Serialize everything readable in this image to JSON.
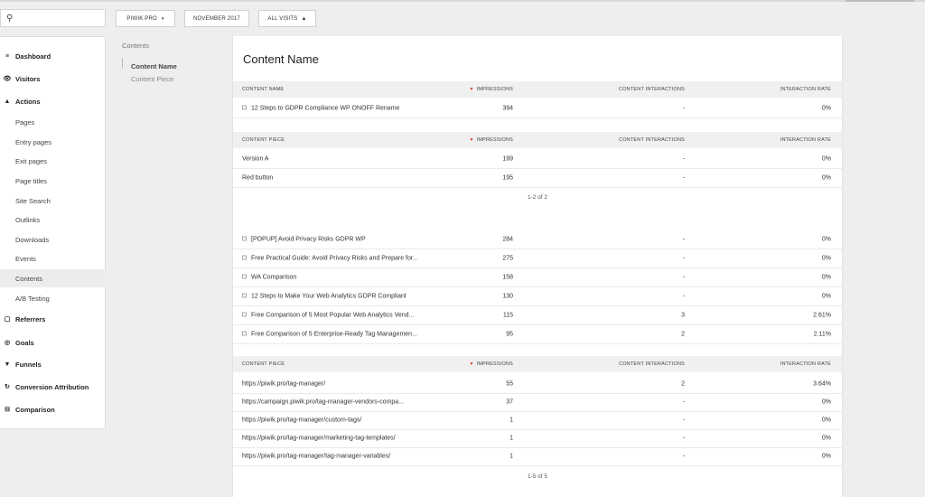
{
  "search": {
    "value": ""
  },
  "topbar": {
    "site": "PIWIK.PRO",
    "period": "NOVEMBER 2017",
    "segment": "ALL VISITS"
  },
  "sidebar": {
    "items": [
      {
        "label": "Dashboard",
        "icon": "hamburger-icon",
        "glyph": "≡",
        "level": "top"
      },
      {
        "label": "Visitors",
        "icon": "eye-icon",
        "glyph": "👁",
        "level": "top"
      },
      {
        "label": "Actions",
        "icon": "pin-icon",
        "glyph": "▲",
        "level": "top"
      },
      {
        "label": "Pages",
        "level": "sub"
      },
      {
        "label": "Entry pages",
        "level": "sub"
      },
      {
        "label": "Exit pages",
        "level": "sub"
      },
      {
        "label": "Page titles",
        "level": "sub"
      },
      {
        "label": "Site Search",
        "level": "sub"
      },
      {
        "label": "Outlinks",
        "level": "sub"
      },
      {
        "label": "Downloads",
        "level": "sub"
      },
      {
        "label": "Events",
        "level": "sub"
      },
      {
        "label": "Contents",
        "level": "sub",
        "active": true
      },
      {
        "label": "A/B Testing",
        "level": "sub"
      },
      {
        "label": "Referrers",
        "icon": "referrers-icon",
        "glyph": "▢",
        "level": "top"
      },
      {
        "label": "Goals",
        "icon": "target-icon",
        "glyph": "◎",
        "level": "top"
      },
      {
        "label": "Funnels",
        "icon": "funnel-icon",
        "glyph": "▼",
        "level": "top"
      },
      {
        "label": "Conversion Attribution",
        "icon": "refresh-icon",
        "glyph": "↻",
        "level": "top"
      },
      {
        "label": "Comparison",
        "icon": "compare-icon",
        "glyph": "⊟",
        "level": "top"
      }
    ]
  },
  "subnav": {
    "header": "Contents",
    "items": [
      {
        "label": "Content Name",
        "active": true
      },
      {
        "label": "Content Piece",
        "active": false
      }
    ]
  },
  "report": {
    "title": "Content Name",
    "main_header": [
      "CONTENT NAME",
      "IMPRESSIONS",
      "CONTENT INTERACTIONS",
      "INTERACTION RATE"
    ],
    "piece_header": [
      "CONTENT PIECE",
      "IMPRESSIONS",
      "CONTENT INTERACTIONS",
      "INTERACTION RATE"
    ],
    "expanded_row": {
      "name": "12 Steps to GDPR Compliance WP ONOFF Rename",
      "impressions": "394",
      "interactions": "-",
      "rate": "0%"
    },
    "pieces_a": [
      {
        "name": "Version A",
        "impressions": "199",
        "interactions": "-",
        "rate": "0%"
      },
      {
        "name": "Red button",
        "impressions": "195",
        "interactions": "-",
        "rate": "0%"
      }
    ],
    "pager_a": "1-2 of 2",
    "names": [
      {
        "name": "[POPUP] Avoid Privacy Risks GDPR WP",
        "impressions": "284",
        "interactions": "-",
        "rate": "0%"
      },
      {
        "name": "Free Practical Guide: Avoid Privacy Risks and Prepare for...",
        "impressions": "275",
        "interactions": "-",
        "rate": "0%"
      },
      {
        "name": "WA Comparison",
        "impressions": "158",
        "interactions": "-",
        "rate": "0%"
      },
      {
        "name": "12 Steps to Make Your Web Analytics GDPR Compliant",
        "impressions": "130",
        "interactions": "-",
        "rate": "0%"
      },
      {
        "name": "Free Comparison of 5 Most Popular Web Analytics Vend...",
        "impressions": "115",
        "interactions": "3",
        "rate": "2.61%"
      },
      {
        "name": "Free Comparison of 5 Enterprise-Ready Tag Managemen...",
        "impressions": "95",
        "interactions": "2",
        "rate": "2.11%"
      }
    ],
    "pieces_b": [
      {
        "name": "https://piwik.pro/tag-manager/",
        "impressions": "55",
        "interactions": "2",
        "rate": "3.64%"
      },
      {
        "name": "https://campaign.piwik.pro/tag-manager-vendors-compa...",
        "impressions": "37",
        "interactions": "-",
        "rate": "0%"
      },
      {
        "name": "https://piwik.pro/tag-manager/custom-tags/",
        "impressions": "1",
        "interactions": "-",
        "rate": "0%"
      },
      {
        "name": "https://piwik.pro/tag-manager/marketing-tag-templates/",
        "impressions": "1",
        "interactions": "-",
        "rate": "0%"
      },
      {
        "name": "https://piwik.pro/tag-manager/tag-manager-variables/",
        "impressions": "1",
        "interactions": "-",
        "rate": "0%"
      }
    ],
    "pager_b": "1-5 of 5"
  },
  "colors": {
    "sort_arrow": "#d9342b",
    "header_bg": "#f0f0f0",
    "active_item_bg": "#ececec"
  }
}
